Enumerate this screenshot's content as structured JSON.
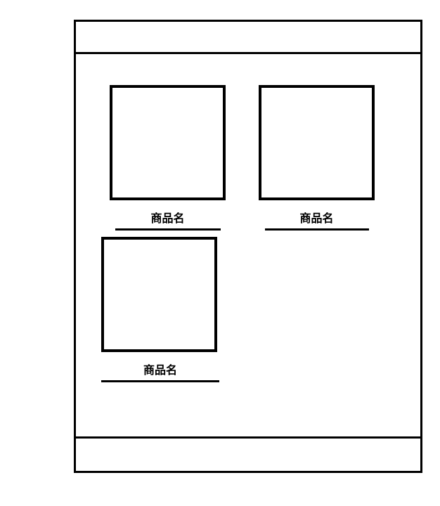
{
  "products": [
    {
      "label": "商品名"
    },
    {
      "label": "商品名"
    },
    {
      "label": "商品名"
    }
  ]
}
